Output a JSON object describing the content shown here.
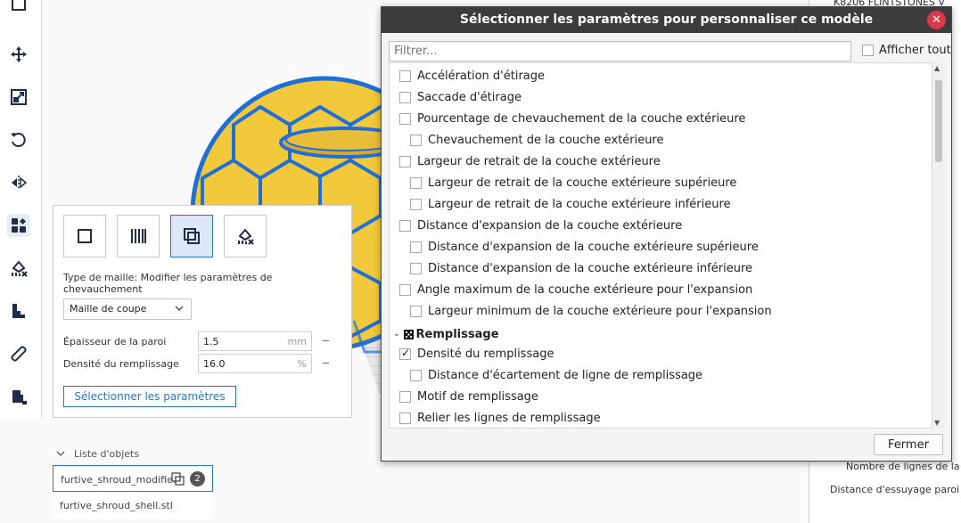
{
  "dialog": {
    "title": "Sélectionner les paramètres pour personnaliser ce modèle",
    "filter_placeholder": "Filtrer...",
    "show_all_label": "Afficher tout",
    "close_button": "Fermer",
    "settings": [
      {
        "label": "Accélération d'étirage",
        "level": 1,
        "checked": false
      },
      {
        "label": "Saccade d'étirage",
        "level": 1,
        "checked": false
      },
      {
        "label": "Pourcentage de chevauchement de la couche extérieure",
        "level": 1,
        "checked": false
      },
      {
        "label": "Chevauchement de la couche extérieure",
        "level": 2,
        "checked": false
      },
      {
        "label": "Largeur de retrait de la couche extérieure",
        "level": 1,
        "checked": false
      },
      {
        "label": "Largeur de retrait de la couche extérieure supérieure",
        "level": 2,
        "checked": false
      },
      {
        "label": "Largeur de retrait de la couche extérieure inférieure",
        "level": 2,
        "checked": false
      },
      {
        "label": "Distance d'expansion de la couche extérieure",
        "level": 1,
        "checked": false
      },
      {
        "label": "Distance d'expansion de la couche extérieure supérieure",
        "level": 2,
        "checked": false
      },
      {
        "label": "Distance d'expansion de la couche extérieure inférieure",
        "level": 2,
        "checked": false
      },
      {
        "label": "Angle maximum de la couche extérieure pour l'expansion",
        "level": 1,
        "checked": false
      },
      {
        "label": "Largeur minimum de la couche extérieure pour l'expansion",
        "level": 2,
        "checked": false
      },
      {
        "label": "Remplissage",
        "category": true
      },
      {
        "label": "Densité du remplissage",
        "level": 1,
        "checked": true
      },
      {
        "label": "Distance d'écartement de ligne de remplissage",
        "level": 2,
        "checked": false
      },
      {
        "label": "Motif de remplissage",
        "level": 1,
        "checked": false
      },
      {
        "label": "Relier les lignes de remplissage",
        "level": 1,
        "checked": false
      }
    ]
  },
  "per_model": {
    "mesh_type_text": "Type de maille: Modifier les paramètres de chevauchement",
    "mesh_dropdown_value": "Maille de coupe",
    "wall_thickness_label": "Épaisseur de la paroi",
    "wall_thickness_value": "1.5",
    "wall_thickness_unit": "mm",
    "infill_density_label": "Densité du remplissage",
    "infill_density_value": "16.0",
    "infill_density_unit": "%",
    "select_settings_button": "Sélectionner les paramètres"
  },
  "object_list": {
    "header": "Liste d'objets",
    "items": [
      {
        "name": "furtive_shroud_modifier",
        "badge": "2"
      },
      {
        "name": "furtive_shroud_shell.stl"
      }
    ]
  },
  "right_panel": {
    "top_text": "K8206 FLINTSTONES V",
    "row1": "Nombre de lignes de la pa",
    "row2": "Distance d'essuyage paroi ex"
  },
  "colors": {
    "accent": "#2a78c4",
    "model_yellow": "#f2c93a",
    "model_outline": "#1f6fd6",
    "close_red": "#d63a4a",
    "dialog_title_bg": "#3c3c3c"
  }
}
